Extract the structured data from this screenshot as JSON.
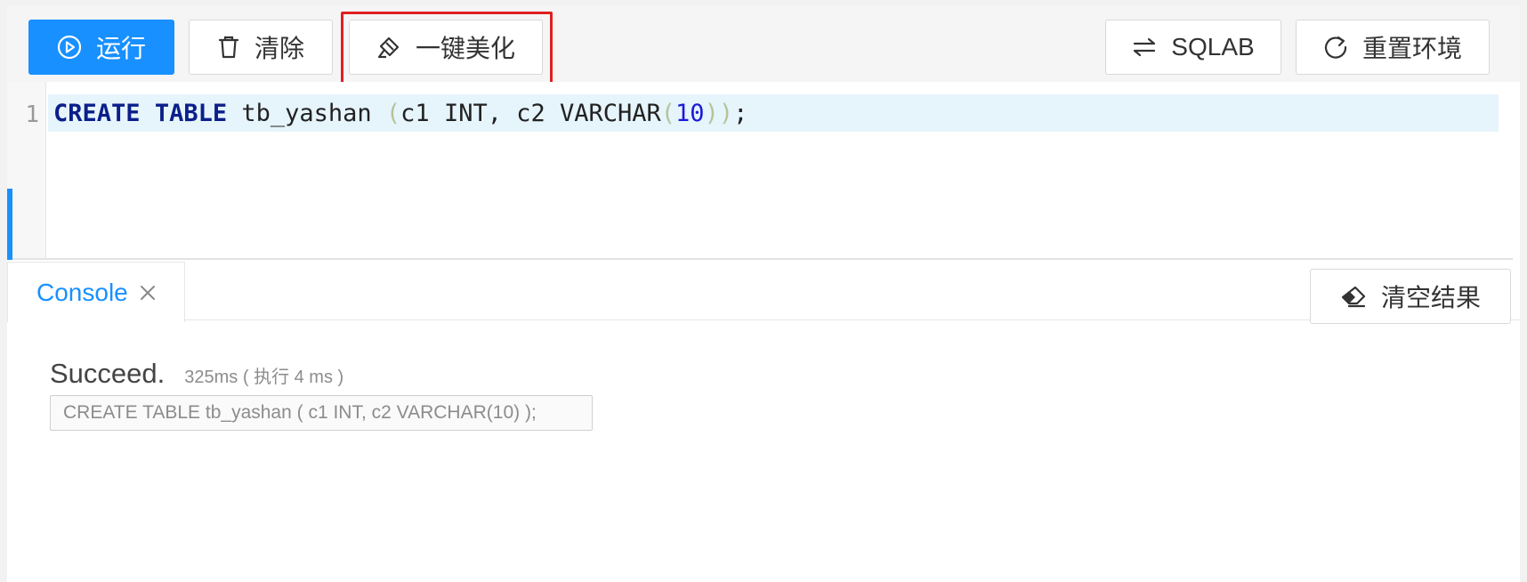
{
  "toolbar": {
    "run_label": "运行",
    "clear_label": "清除",
    "beautify_label": "一键美化",
    "sqlab_label": "SQLAB",
    "reset_label": "重置环境"
  },
  "editor": {
    "line_number": "1",
    "tokens": {
      "kw_create": "CREATE",
      "kw_table": "TABLE",
      "table_name": " tb_yashan ",
      "open_paren": "(",
      "columns": "c1 INT, c2 VARCHAR",
      "open_paren_inner": "(",
      "length": "10",
      "close_parens": "))",
      "semicolon": ";"
    }
  },
  "console": {
    "tab_label": "Console",
    "clear_results_label": "清空结果",
    "status": "Succeed.",
    "timing": "325ms ( 执行 4 ms )",
    "executed_sql": "CREATE TABLE tb_yashan ( c1 INT, c2 VARCHAR(10) );"
  },
  "colors": {
    "primary": "#1890ff",
    "highlight_border": "#e02020",
    "keyword": "#0b1f8a",
    "number": "#1a1ad8",
    "active_line": "#e6f4fc"
  }
}
